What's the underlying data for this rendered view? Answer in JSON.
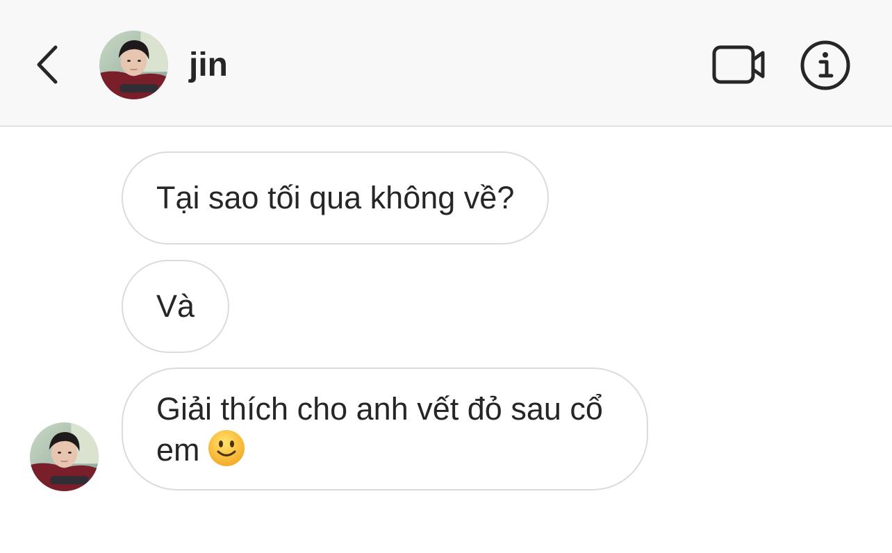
{
  "header": {
    "back_icon": "chevron-left-icon",
    "avatar_icon": "profile-photo",
    "username": "jin",
    "video_icon": "video-camera-icon",
    "info_icon": "info-icon"
  },
  "messages": [
    {
      "text": "Tại sao tối qua không về?"
    },
    {
      "text": "Và"
    },
    {
      "text": "Giải thích cho anh vết đỏ sau cổ em",
      "emoji": "slightly-smiling-face-emoji"
    }
  ],
  "colors": {
    "header_bg": "#f8f8f8",
    "text": "#262626",
    "bubble_border": "#dbdbdb",
    "divider": "#c9c9c9"
  }
}
